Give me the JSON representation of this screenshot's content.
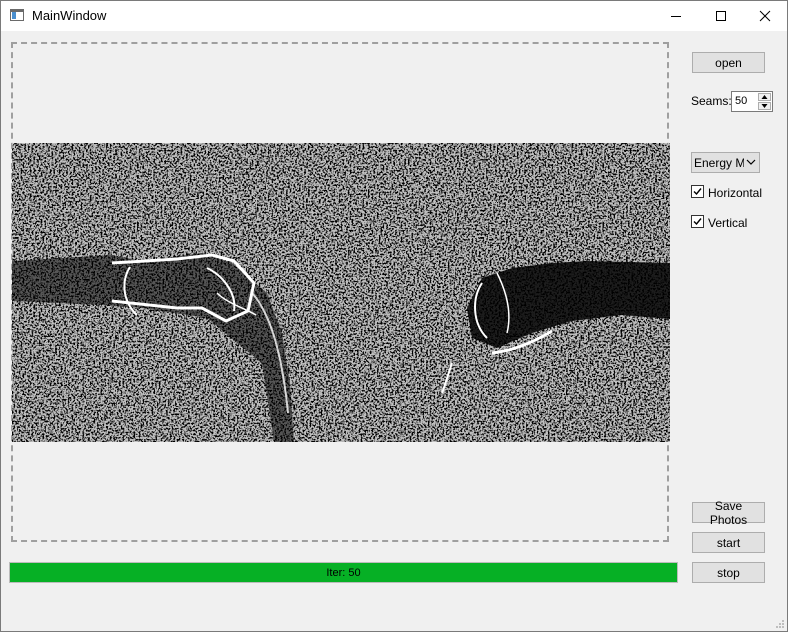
{
  "window": {
    "title": "MainWindow",
    "icon": "app-window-icon",
    "controls": [
      "minimize-icon",
      "maximize-icon",
      "close-icon"
    ]
  },
  "image_panel": {
    "description_icon": "image-preview"
  },
  "sidebar": {
    "open_label": "open",
    "seams_label": "Seams:",
    "seams_value": "50",
    "energy_selected": "Energy M",
    "horizontal_label": "Horizontal",
    "horizontal_checked": true,
    "vertical_label": "Vertical",
    "vertical_checked": true,
    "save_label": "Save Photos",
    "start_label": "start",
    "stop_label": "stop"
  },
  "progress": {
    "text": "Iter: 50",
    "fraction": 1.0,
    "color": "#06b025"
  }
}
